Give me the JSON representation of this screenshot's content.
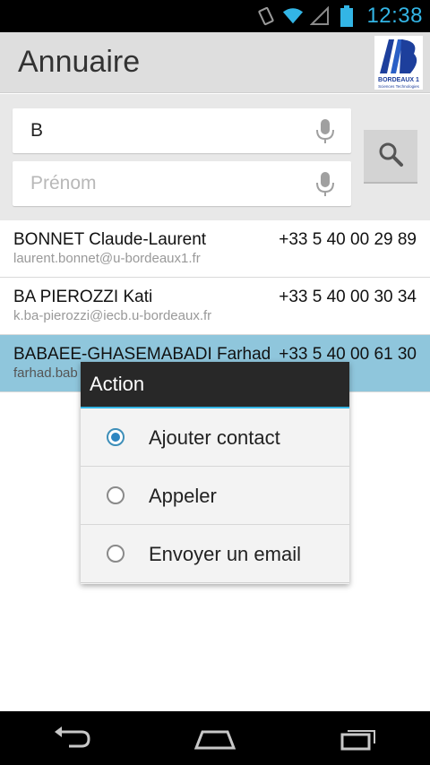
{
  "status_bar": {
    "time": "12:38",
    "icons": [
      "vibrate-icon",
      "wifi-icon",
      "signal-icon",
      "battery-icon"
    ],
    "accent_color": "#33b5e5"
  },
  "app": {
    "title": "Annuaire",
    "logo_text": "BORDEAUX 1",
    "logo_subtext": "Sciences Technologies"
  },
  "search": {
    "name_value": "B",
    "firstname_placeholder": "Prénom",
    "button_icon": "search-icon"
  },
  "contacts": [
    {
      "name": "BONNET Claude-Laurent",
      "phone": "+33 5 40 00 29 89",
      "email": "laurent.bonnet@u-bordeaux1.fr"
    },
    {
      "name": "BA PIEROZZI Kati",
      "phone": "+33 5 40 00 30 34",
      "email": "k.ba-pierozzi@iecb.u-bordeaux.fr"
    },
    {
      "name": "BABAEE-GHASEMABADI Farhad",
      "phone": "+33 5 40 00 61 30",
      "email": "farhad.bab"
    }
  ],
  "selected_color": "#8fc6dc",
  "dialog": {
    "title": "Action",
    "options": [
      {
        "label": "Ajouter contact",
        "checked": true
      },
      {
        "label": "Appeler",
        "checked": false
      },
      {
        "label": "Envoyer un email",
        "checked": false
      }
    ]
  },
  "nav_bar": {
    "icons": [
      "back-icon",
      "home-icon",
      "recent-apps-icon"
    ]
  }
}
